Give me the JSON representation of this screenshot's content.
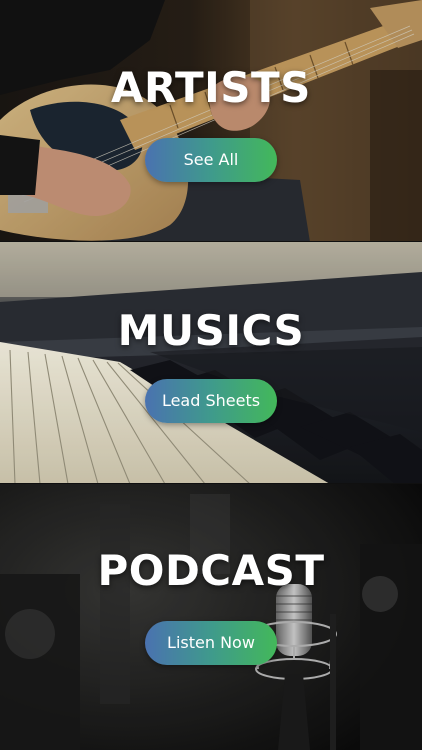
{
  "sections": [
    {
      "title": "ARTISTS",
      "button_label": "See All"
    },
    {
      "title": "MUSICS",
      "button_label": "Lead Sheets"
    },
    {
      "title": "PODCAST",
      "button_label": "Listen Now"
    }
  ],
  "colors": {
    "button_gradient_start": "#4a72b0",
    "button_gradient_end": "#43b85a",
    "title_text": "#ffffff"
  }
}
